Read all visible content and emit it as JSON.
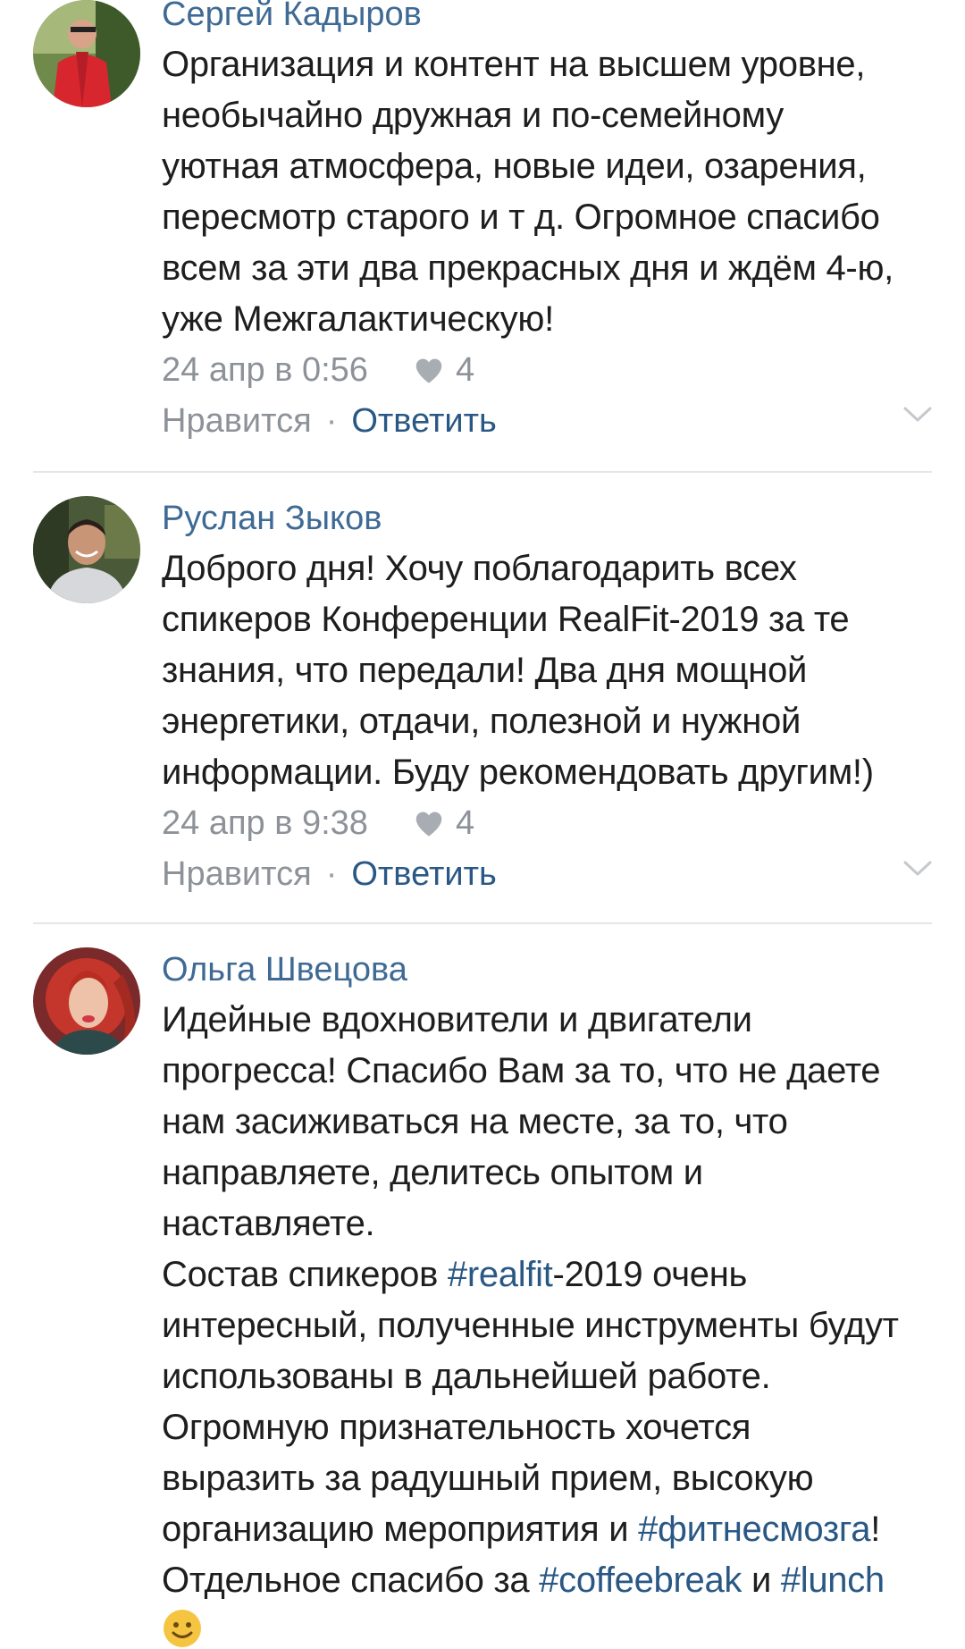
{
  "comments": [
    {
      "author": "Сергей Кадыров",
      "text": "Организация и контент на высшем уровне,\nнеобычайно дружная и по-семейному\nуютная атмосфера, новые идеи, озарения,\nпересмотр старого и т д. Огромное спасибо\nвсем за эти два прекрасных дня и ждём 4-ю,\nуже Межгалактическую!",
      "date": "24 апр в 0:56",
      "likes": "4",
      "like_label": "Нравится",
      "separator": "·",
      "reply_label": "Ответить"
    },
    {
      "author": "Руслан Зыков",
      "text": "Доброго дня! Хочу поблагодарить всех\nспикеров Конференции RealFit-2019 за те\nзнания, что передали! Два дня мощной\nэнергетики, отдачи, полезной и нужной\nинформации. Буду рекомендовать другим!)",
      "date": "24 апр в 9:38",
      "likes": "4",
      "like_label": "Нравится",
      "separator": "·",
      "reply_label": "Ответить"
    },
    {
      "author": "Ольга Швецова",
      "text_parts": {
        "p1": "Идейные вдохновители и двигатели\nпрогресса! Спасибо Вам за то, что не даете\nнам засиживаться на месте, за то, что\nнаправляете, делитесь опытом и\nнаставляете.\nСостав спикеров ",
        "tag1": "#realfit",
        "p2": "-2019 очень\nинтересный, полученные инструменты будут\nиспользованы в дальнейшей работе.\nОгромную признательность хочется\nвыразить за радушный прием, высокую\nорганизацию мероприятия и ",
        "tag2": "#фитнесмозга",
        "p3": "!\nОтдельное спасибо за ",
        "tag3": "#coffeebreak",
        "p4": " и ",
        "tag4": "#lunch"
      }
    }
  ],
  "colors": {
    "author": "#3f6a94",
    "link": "#2a5885",
    "meta": "#8d9299",
    "divider": "#e4e6ea"
  },
  "icons": [
    "heart-icon",
    "chevron-down-icon",
    "smile-emoji-icon"
  ]
}
